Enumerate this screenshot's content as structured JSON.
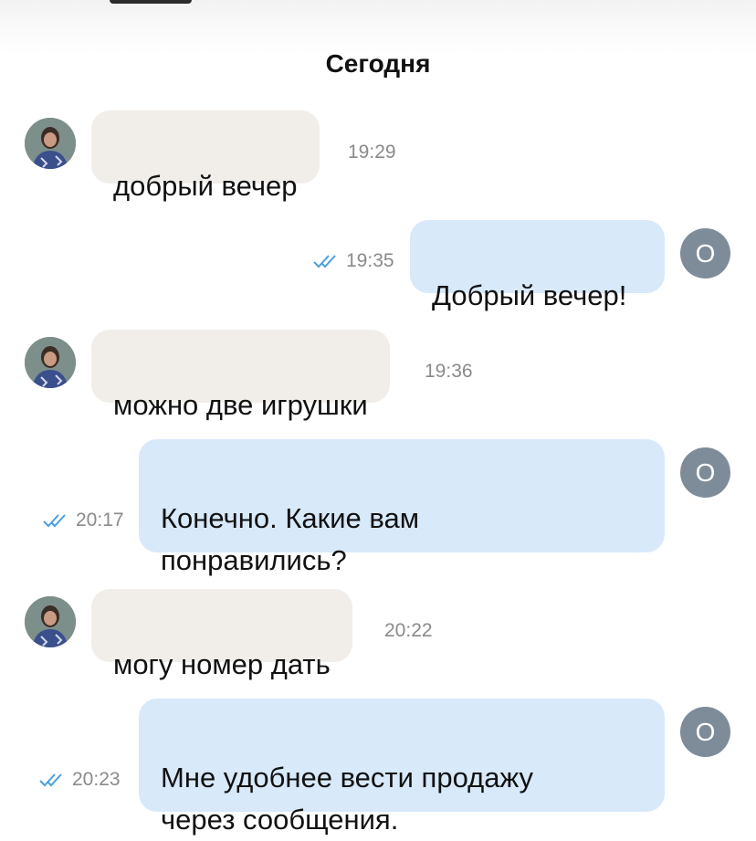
{
  "date_header": "Сегодня",
  "colors": {
    "incoming_bubble": "#f1eeea",
    "outgoing_bubble": "#d8e9fa",
    "avatar_letter_bg": "#7e8c99",
    "read_check": "#4a9fe0",
    "time_text": "#8a8a8a"
  },
  "messages": [
    {
      "direction": "in",
      "text": "добрый вечер",
      "time": "19:29"
    },
    {
      "direction": "out",
      "text": "Добрый вечер!",
      "time": "19:35",
      "status": "read",
      "status_icon": "double-check-icon"
    },
    {
      "direction": "in",
      "text": "можно две игрушки",
      "time": "19:36"
    },
    {
      "direction": "out",
      "text": "Конечно. Какие вам\nпонравились?",
      "time": "20:17",
      "status": "read",
      "status_icon": "double-check-icon"
    },
    {
      "direction": "in",
      "text": "могу номер дать",
      "time": "20:22"
    },
    {
      "direction": "out",
      "text": "Мне удобнее вести продажу\nчерез сообщения.",
      "time": "20:23",
      "status": "read",
      "status_icon": "double-check-icon"
    }
  ],
  "outgoing_avatar_letter": "О"
}
